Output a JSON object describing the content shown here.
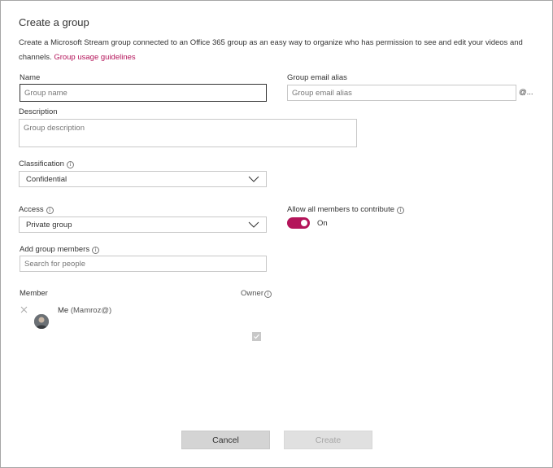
{
  "dialog": {
    "title": "Create a group",
    "description": "Create a Microsoft Stream group connected to an Office 365 group as an easy way to organize who has permission to see and edit your videos and channels.",
    "guidelines_link": "Group usage guidelines"
  },
  "form": {
    "name_label": "Name",
    "name_placeholder": "Group name",
    "email_label": "Group email alias",
    "email_placeholder": "Group email alias",
    "email_suffix": "@...",
    "description_label": "Description",
    "description_placeholder": "Group description",
    "classification_label": "Classification",
    "classification_value": "Confidential",
    "access_label": "Access",
    "access_value": "Private group",
    "contribute_label": "Allow all members to contribute",
    "contribute_state": "On",
    "members_label": "Add group members",
    "members_placeholder": "Search for people",
    "info_glyph": "i"
  },
  "members_table": {
    "member_header": "Member",
    "owner_header": "Owner",
    "rows": [
      {
        "name": "Me",
        "alias": "(Mamroz@)",
        "owner": true
      }
    ]
  },
  "footer": {
    "cancel_label": "Cancel",
    "create_label": "Create"
  },
  "colors": {
    "accent": "#b4145a",
    "border": "#c8c8c8",
    "button_bg": "#d4d4d4"
  }
}
